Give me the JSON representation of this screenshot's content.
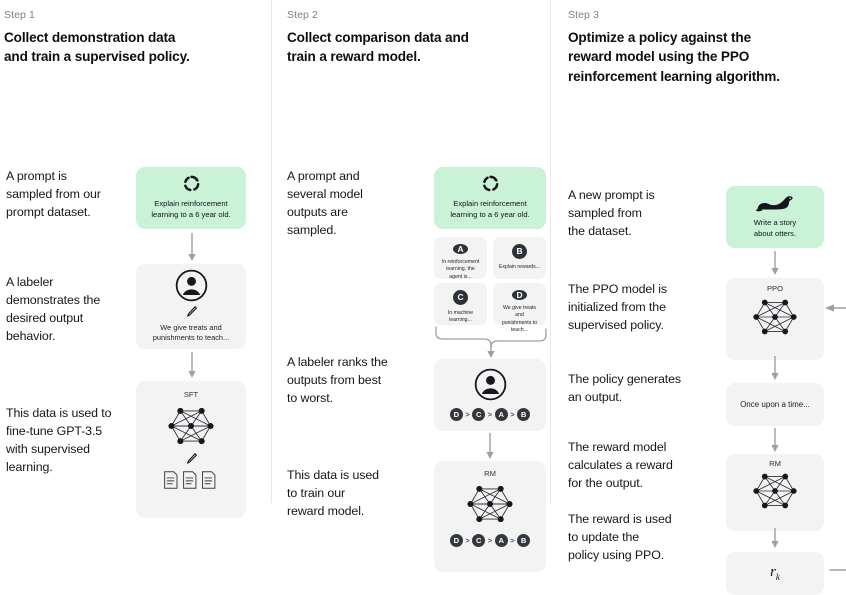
{
  "meta": {
    "diagram_title": "InstructGPT / RLHF three-step training process",
    "accent_green": "#c9f2d7",
    "box_grey": "#f3f3f3",
    "badge_dark": "#2d3138",
    "divider": "#e6e7e8"
  },
  "steps": [
    {
      "label": "Step 1",
      "title": "Collect demonstration data\nand train a supervised policy.",
      "descriptions": [
        "A prompt is\nsampled from our\nprompt dataset.",
        "A labeler\ndemonstrates the\ndesired output\nbehavior.",
        "This data is used to\nfine-tune GPT-3.5\nwith supervised\nlearning."
      ],
      "boxes": [
        {
          "kind": "prompt",
          "icon": "dashed-circle-icon",
          "caption": "Explain reinforcement\nlearning to a 6 year old."
        },
        {
          "kind": "labeler",
          "icon": "person-circle-icon",
          "sub_icon": "pencil-icon",
          "caption": "We give treats and\npunishments to teach..."
        },
        {
          "kind": "model",
          "tag": "SFT",
          "icon": "neural-network-icon",
          "sub_icon": "pencil-icon",
          "extra_icon": "documents-icon"
        }
      ]
    },
    {
      "label": "Step 2",
      "title": "Collect comparison data and\ntrain a reward model.",
      "descriptions": [
        "A prompt and\nseveral model\noutputs are\nsampled.",
        "A labeler ranks the\noutputs from best\nto worst.",
        "This data is used\nto train our\nreward model."
      ],
      "boxes": [
        {
          "kind": "prompt",
          "icon": "dashed-circle-icon",
          "caption": "Explain reinforcement\nlearning to a 6 year old."
        },
        {
          "kind": "options",
          "cards": [
            {
              "badge": "A",
              "text": "In reinforcement\nlearning, the\nagent is..."
            },
            {
              "badge": "B",
              "text": "Explain rewards..."
            },
            {
              "badge": "C",
              "text": "In machine\nlearning..."
            },
            {
              "badge": "D",
              "text": "We give treats and\npunishments to\nteach..."
            }
          ]
        },
        {
          "kind": "labeler-rank",
          "icon": "person-circle-icon",
          "ranking": [
            "D",
            "C",
            "A",
            "B"
          ]
        },
        {
          "kind": "model-rank",
          "tag": "RM",
          "icon": "neural-network-icon",
          "ranking": [
            "D",
            "C",
            "A",
            "B"
          ]
        }
      ]
    },
    {
      "label": "Step 3",
      "title": "Optimize a policy against the\nreward model using the PPO\nreinforcement learning algorithm.",
      "descriptions": [
        "A new prompt is\nsampled from\nthe dataset.",
        "The PPO model is\ninitialized from the\nsupervised policy.",
        "The policy generates\nan output.",
        "The reward model\ncalculates a reward\nfor the output.",
        "The reward is used\nto update the\npolicy using PPO."
      ],
      "boxes": [
        {
          "kind": "prompt",
          "icon": "otter-icon",
          "caption": "Write a story\nabout otters."
        },
        {
          "kind": "model",
          "tag": "PPO",
          "icon": "neural-network-icon"
        },
        {
          "kind": "output",
          "caption": "Once upon a time..."
        },
        {
          "kind": "model",
          "tag": "RM",
          "icon": "neural-network-icon"
        },
        {
          "kind": "reward",
          "symbol": "r",
          "subscript": "k"
        }
      ],
      "feedback_loop": "reward-to-ppo-loop-arrow"
    }
  ]
}
